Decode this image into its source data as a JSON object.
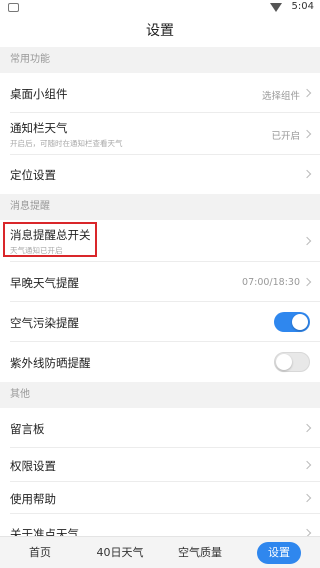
{
  "status_bar": {
    "time": "5:04"
  },
  "header": {
    "title": "设置"
  },
  "sections": {
    "common": "常用功能",
    "reminders": "消息提醒",
    "other": "其他"
  },
  "rows": {
    "widget": {
      "label": "桌面小组件",
      "value": "选择组件"
    },
    "notify_weather": {
      "label": "通知栏天气",
      "sub": "开启后，可随时在通知栏查看天气",
      "value": "已开启"
    },
    "location": {
      "label": "定位设置"
    },
    "master_switch": {
      "label": "消息提醒总开关",
      "sub": "天气通知已开启"
    },
    "morning_evening": {
      "label": "早晚天气提醒",
      "value": "07:00/18:30"
    },
    "air_pollution": {
      "label": "空气污染提醒",
      "toggle": "on"
    },
    "uv": {
      "label": "紫外线防晒提醒",
      "toggle": "off"
    },
    "message_board": {
      "label": "留言板"
    },
    "permissions": {
      "label": "权限设置"
    },
    "help": {
      "label": "使用帮助"
    },
    "about": {
      "label": "关于准点天气"
    }
  },
  "tabs": [
    {
      "label": "首页"
    },
    {
      "label": "40日天气"
    },
    {
      "label": "空气质量"
    },
    {
      "label": "设置",
      "active": true
    }
  ],
  "colors": {
    "accent": "#2f87ee",
    "highlight": "#d9262a",
    "section_bg": "#f2f2f2"
  }
}
